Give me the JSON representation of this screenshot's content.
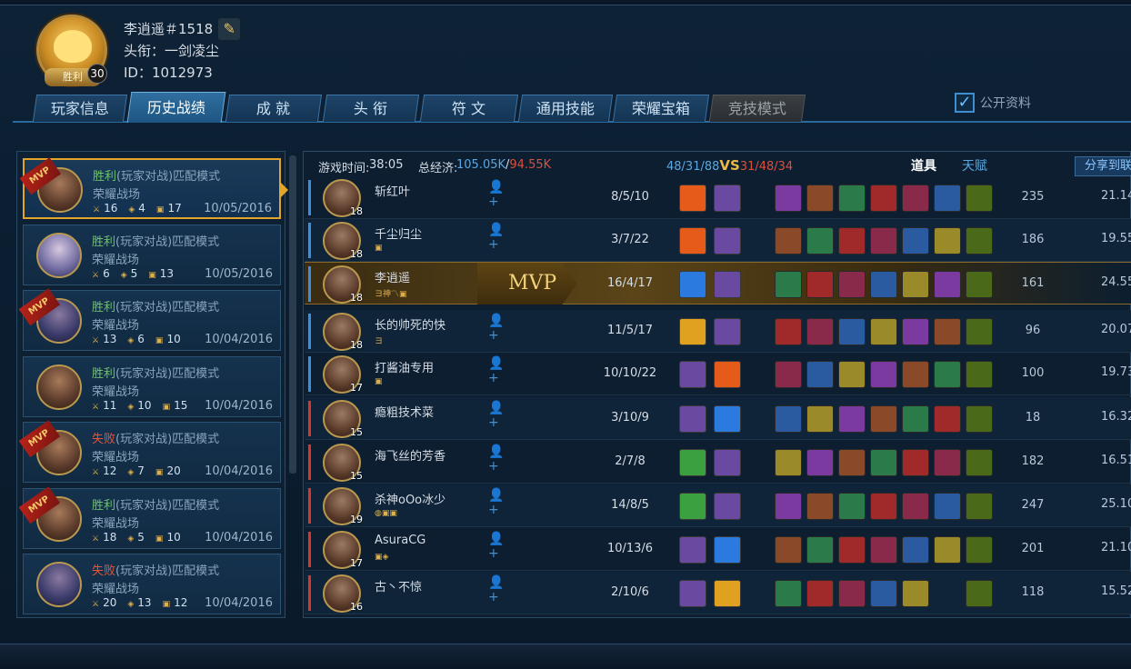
{
  "player": {
    "name": "李逍遥＃1518",
    "title_label": "头衔：一剑凌尘",
    "id_label": "ID：1012973",
    "level": "30",
    "crest_text": "胜利"
  },
  "tabs": [
    "玩家信息",
    "历史战绩",
    "成 就",
    "头 衔",
    "符 文",
    "通用技能",
    "荣耀宝箱",
    "竞技模式"
  ],
  "public_label": "公开资料",
  "matches": [
    {
      "result": "胜利",
      "mode": "(玩家对战)匹配模式",
      "field": "荣耀战场",
      "k": "16",
      "d": "4",
      "a": "17",
      "date": "10/05/2016",
      "mvp": "MVP"
    },
    {
      "result": "胜利",
      "mode": "(玩家对战)匹配模式",
      "field": "荣耀战场",
      "k": "6",
      "d": "5",
      "a": "13",
      "date": "10/05/2016",
      "mvp": ""
    },
    {
      "result": "胜利",
      "mode": "(玩家对战)匹配模式",
      "field": "荣耀战场",
      "k": "13",
      "d": "6",
      "a": "10",
      "date": "10/04/2016",
      "mvp": "MVP"
    },
    {
      "result": "胜利",
      "mode": "(玩家对战)匹配模式",
      "field": "荣耀战场",
      "k": "11",
      "d": "10",
      "a": "15",
      "date": "10/04/2016",
      "mvp": ""
    },
    {
      "result": "失败",
      "mode": "(玩家对战)匹配模式",
      "field": "荣耀战场",
      "k": "12",
      "d": "7",
      "a": "20",
      "date": "10/04/2016",
      "mvp": "MVP"
    },
    {
      "result": "胜利",
      "mode": "(玩家对战)匹配模式",
      "field": "荣耀战场",
      "k": "18",
      "d": "5",
      "a": "10",
      "date": "10/04/2016",
      "mvp": "MVP"
    },
    {
      "result": "失败",
      "mode": "(玩家对战)匹配模式",
      "field": "荣耀战场",
      "k": "20",
      "d": "13",
      "a": "12",
      "date": "10/04/2016",
      "mvp": ""
    }
  ],
  "header": {
    "time_label": "游戏时间:",
    "time_value": "38:05",
    "econ_label": "总经济:",
    "econ_blue": "105.05K",
    "econ_sep": "/",
    "econ_red": "94.55K",
    "kda_blue": "48/31/88",
    "vs": "VS",
    "kda_red": "31/48/34",
    "items_tab": "道具",
    "talent_tab": "天赋",
    "share": "分享到联"
  },
  "players": [
    {
      "name": "斩红叶",
      "level": "18",
      "kda": "8/5/10",
      "score": "235",
      "rating": "21.14",
      "team": "blue",
      "tag": ""
    },
    {
      "name": "千尘归尘",
      "level": "18",
      "kda": "3/7/22",
      "score": "186",
      "rating": "19.55",
      "team": "blue",
      "tag": "▣"
    },
    {
      "name": "李逍遥",
      "level": "18",
      "kda": "16/4/17",
      "score": "161",
      "rating": "24.55",
      "team": "blue",
      "tag": "ヨ神〽▣",
      "mvp": "MVP"
    },
    {
      "name": "长的帅死的快",
      "level": "18",
      "kda": "11/5/17",
      "score": "96",
      "rating": "20.07",
      "team": "blue",
      "tag": "ヨ"
    },
    {
      "name": "打酱油专用",
      "level": "17",
      "kda": "10/10/22",
      "score": "100",
      "rating": "19.73",
      "team": "blue",
      "tag": "▣"
    },
    {
      "name": "瘾粗技术菜",
      "level": "15",
      "kda": "3/10/9",
      "score": "18",
      "rating": "16.32",
      "team": "red",
      "tag": ""
    },
    {
      "name": "海飞丝的芳香",
      "level": "15",
      "kda": "2/7/8",
      "score": "182",
      "rating": "16.51",
      "team": "red",
      "tag": ""
    },
    {
      "name": "杀神oOo冰少",
      "level": "19",
      "kda": "14/8/5",
      "score": "247",
      "rating": "25.10",
      "team": "red",
      "tag": "◍▣▣"
    },
    {
      "name": "AsuraCG",
      "level": "17",
      "kda": "10/13/6",
      "score": "201",
      "rating": "21.10",
      "team": "red",
      "tag": "▣◈"
    },
    {
      "name": "古丶不惊",
      "level": "16",
      "kda": "2/10/6",
      "score": "118",
      "rating": "15.52",
      "team": "red",
      "tag": ""
    }
  ],
  "colors": {
    "blue_team": "#3a8fe0",
    "red_team": "#d9362b",
    "win": "#6cc36b",
    "lose": "#e0573b",
    "gold": "#e3a42a"
  }
}
